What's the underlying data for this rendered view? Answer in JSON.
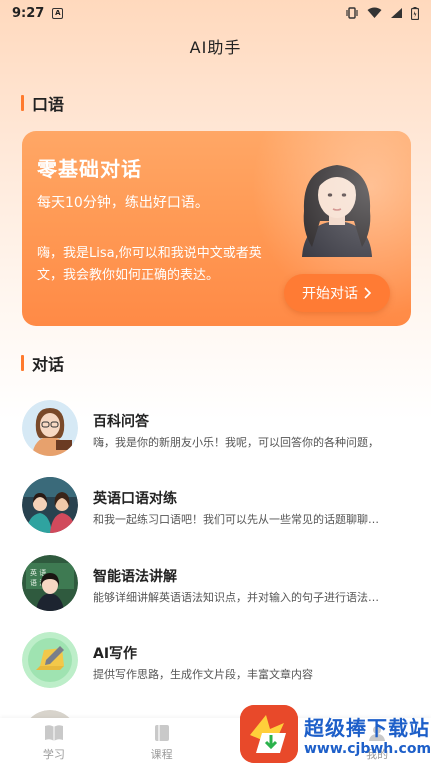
{
  "status": {
    "time": "9:27",
    "notif": "A"
  },
  "title": "AI助手",
  "speaking_section": {
    "title": "口语"
  },
  "card": {
    "title": "零基础对话",
    "subtitle": "每天10分钟，练出好口语。",
    "desc": "嗨，我是Lisa,你可以和我说中文或者英文，我会教你如何正确的表达。",
    "button": "开始对话"
  },
  "dialog_section": {
    "title": "对话"
  },
  "items": [
    {
      "title": "百科问答",
      "desc": "嗨，我是你的新朋友小乐！我呢，可以回答你的各种问题，"
    },
    {
      "title": "英语口语对练",
      "desc": "和我一起练习口语吧！我们可以先从一些常见的话题聊聊比..."
    },
    {
      "title": "智能语法讲解",
      "desc": "能够详细讲解英语语法知识点，并对输入的句子进行语法纠..."
    },
    {
      "title": "AI写作",
      "desc": "提供写作思路，生成作文片段，丰富文章内容"
    }
  ],
  "tabs": [
    {
      "label": "学习"
    },
    {
      "label": "课程"
    },
    {
      "label": ""
    },
    {
      "label": "我的"
    }
  ],
  "watermark": {
    "title": "超级捧下载站",
    "url": "www.cjbwh.com"
  },
  "colors": {
    "accent": "#ff7a2e",
    "card": "#ff9a55",
    "watermark_blue": "#1d5fc9"
  }
}
